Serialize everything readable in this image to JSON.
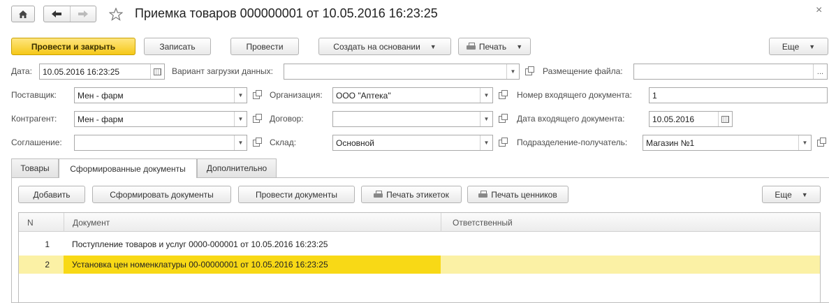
{
  "window": {
    "title": "Приемка товаров 000000001 от 10.05.2016 16:23:25",
    "close_glyph": "×"
  },
  "toolbar": {
    "post_close": "Провести и закрыть",
    "save": "Записать",
    "post": "Провести",
    "create_based": "Создать на основании",
    "print": "Печать",
    "more": "Еще"
  },
  "form": {
    "date_label": "Дата:",
    "date_value": "10.05.2016 16:23:25",
    "load_variant_label": "Вариант загрузки данных:",
    "load_variant_value": "",
    "file_location_label": "Размещение файла:",
    "file_location_value": "",
    "file_location_btn": "...",
    "supplier_label": "Поставщик:",
    "supplier_value": "Мен - фарм",
    "organization_label": "Организация:",
    "organization_value": "ООО \"Аптека\"",
    "incoming_num_label": "Номер входящего документа:",
    "incoming_num_value": "1",
    "counterparty_label": "Контрагент:",
    "counterparty_value": "Мен - фарм",
    "contract_label": "Договор:",
    "contract_value": "",
    "incoming_date_label": "Дата входящего документа:",
    "incoming_date_value": "10.05.2016",
    "agreement_label": "Соглашение:",
    "agreement_value": "",
    "warehouse_label": "Склад:",
    "warehouse_value": "Основной",
    "recipient_label": "Подразделение-получатель:",
    "recipient_value": "Магазин №1"
  },
  "tabs": [
    {
      "label": "Товары",
      "active": false
    },
    {
      "label": "Сформированные документы",
      "active": true
    },
    {
      "label": "Дополнительно",
      "active": false
    }
  ],
  "panel_toolbar": {
    "add": "Добавить",
    "generate": "Сформировать документы",
    "post_docs": "Провести документы",
    "print_labels": "Печать этикеток",
    "print_prices": "Печать ценников",
    "more": "Еще"
  },
  "table": {
    "columns": [
      "N",
      "Документ",
      "Ответственный"
    ],
    "rows": [
      {
        "n": "1",
        "document": "Поступление товаров и услуг 0000-000001 от 10.05.2016 16:23:25",
        "responsible": ""
      },
      {
        "n": "2",
        "document": "Установка цен номенклатуры 00-00000001 от 10.05.2016 16:23:25",
        "responsible": ""
      }
    ]
  },
  "colors": {
    "primary_button": "#f5c818",
    "selected_row": "#fbf1a5",
    "selected_cell": "#f8d916"
  }
}
